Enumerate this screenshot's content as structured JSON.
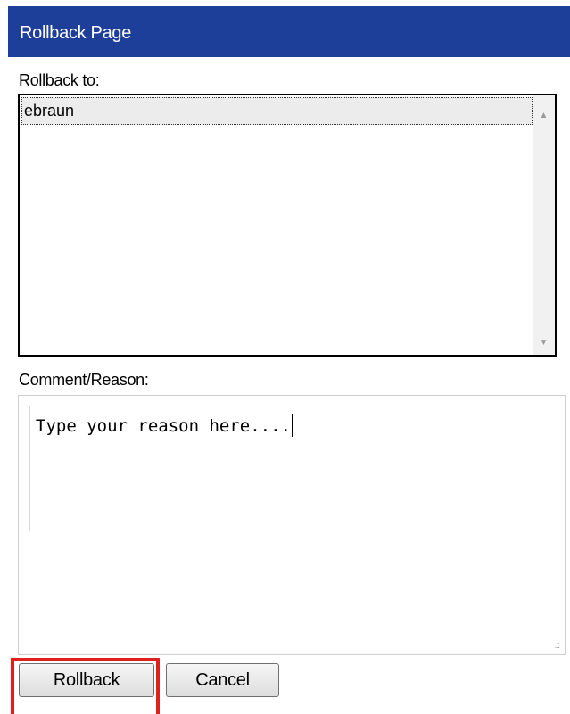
{
  "dialog": {
    "title": "Rollback Page"
  },
  "rollback_to": {
    "label": "Rollback to:",
    "items": [
      "ebraun"
    ],
    "selected": "ebraun"
  },
  "comment": {
    "label": "Comment/Reason:",
    "value": "Type your reason here...."
  },
  "buttons": {
    "rollback": "Rollback",
    "cancel": "Cancel"
  },
  "colors": {
    "titlebar": "#1d3f99",
    "highlight": "#e0201b"
  },
  "icons": {
    "scroll_up": "triangle-up-icon",
    "scroll_down": "triangle-down-icon",
    "resize": "resize-grip-icon"
  }
}
